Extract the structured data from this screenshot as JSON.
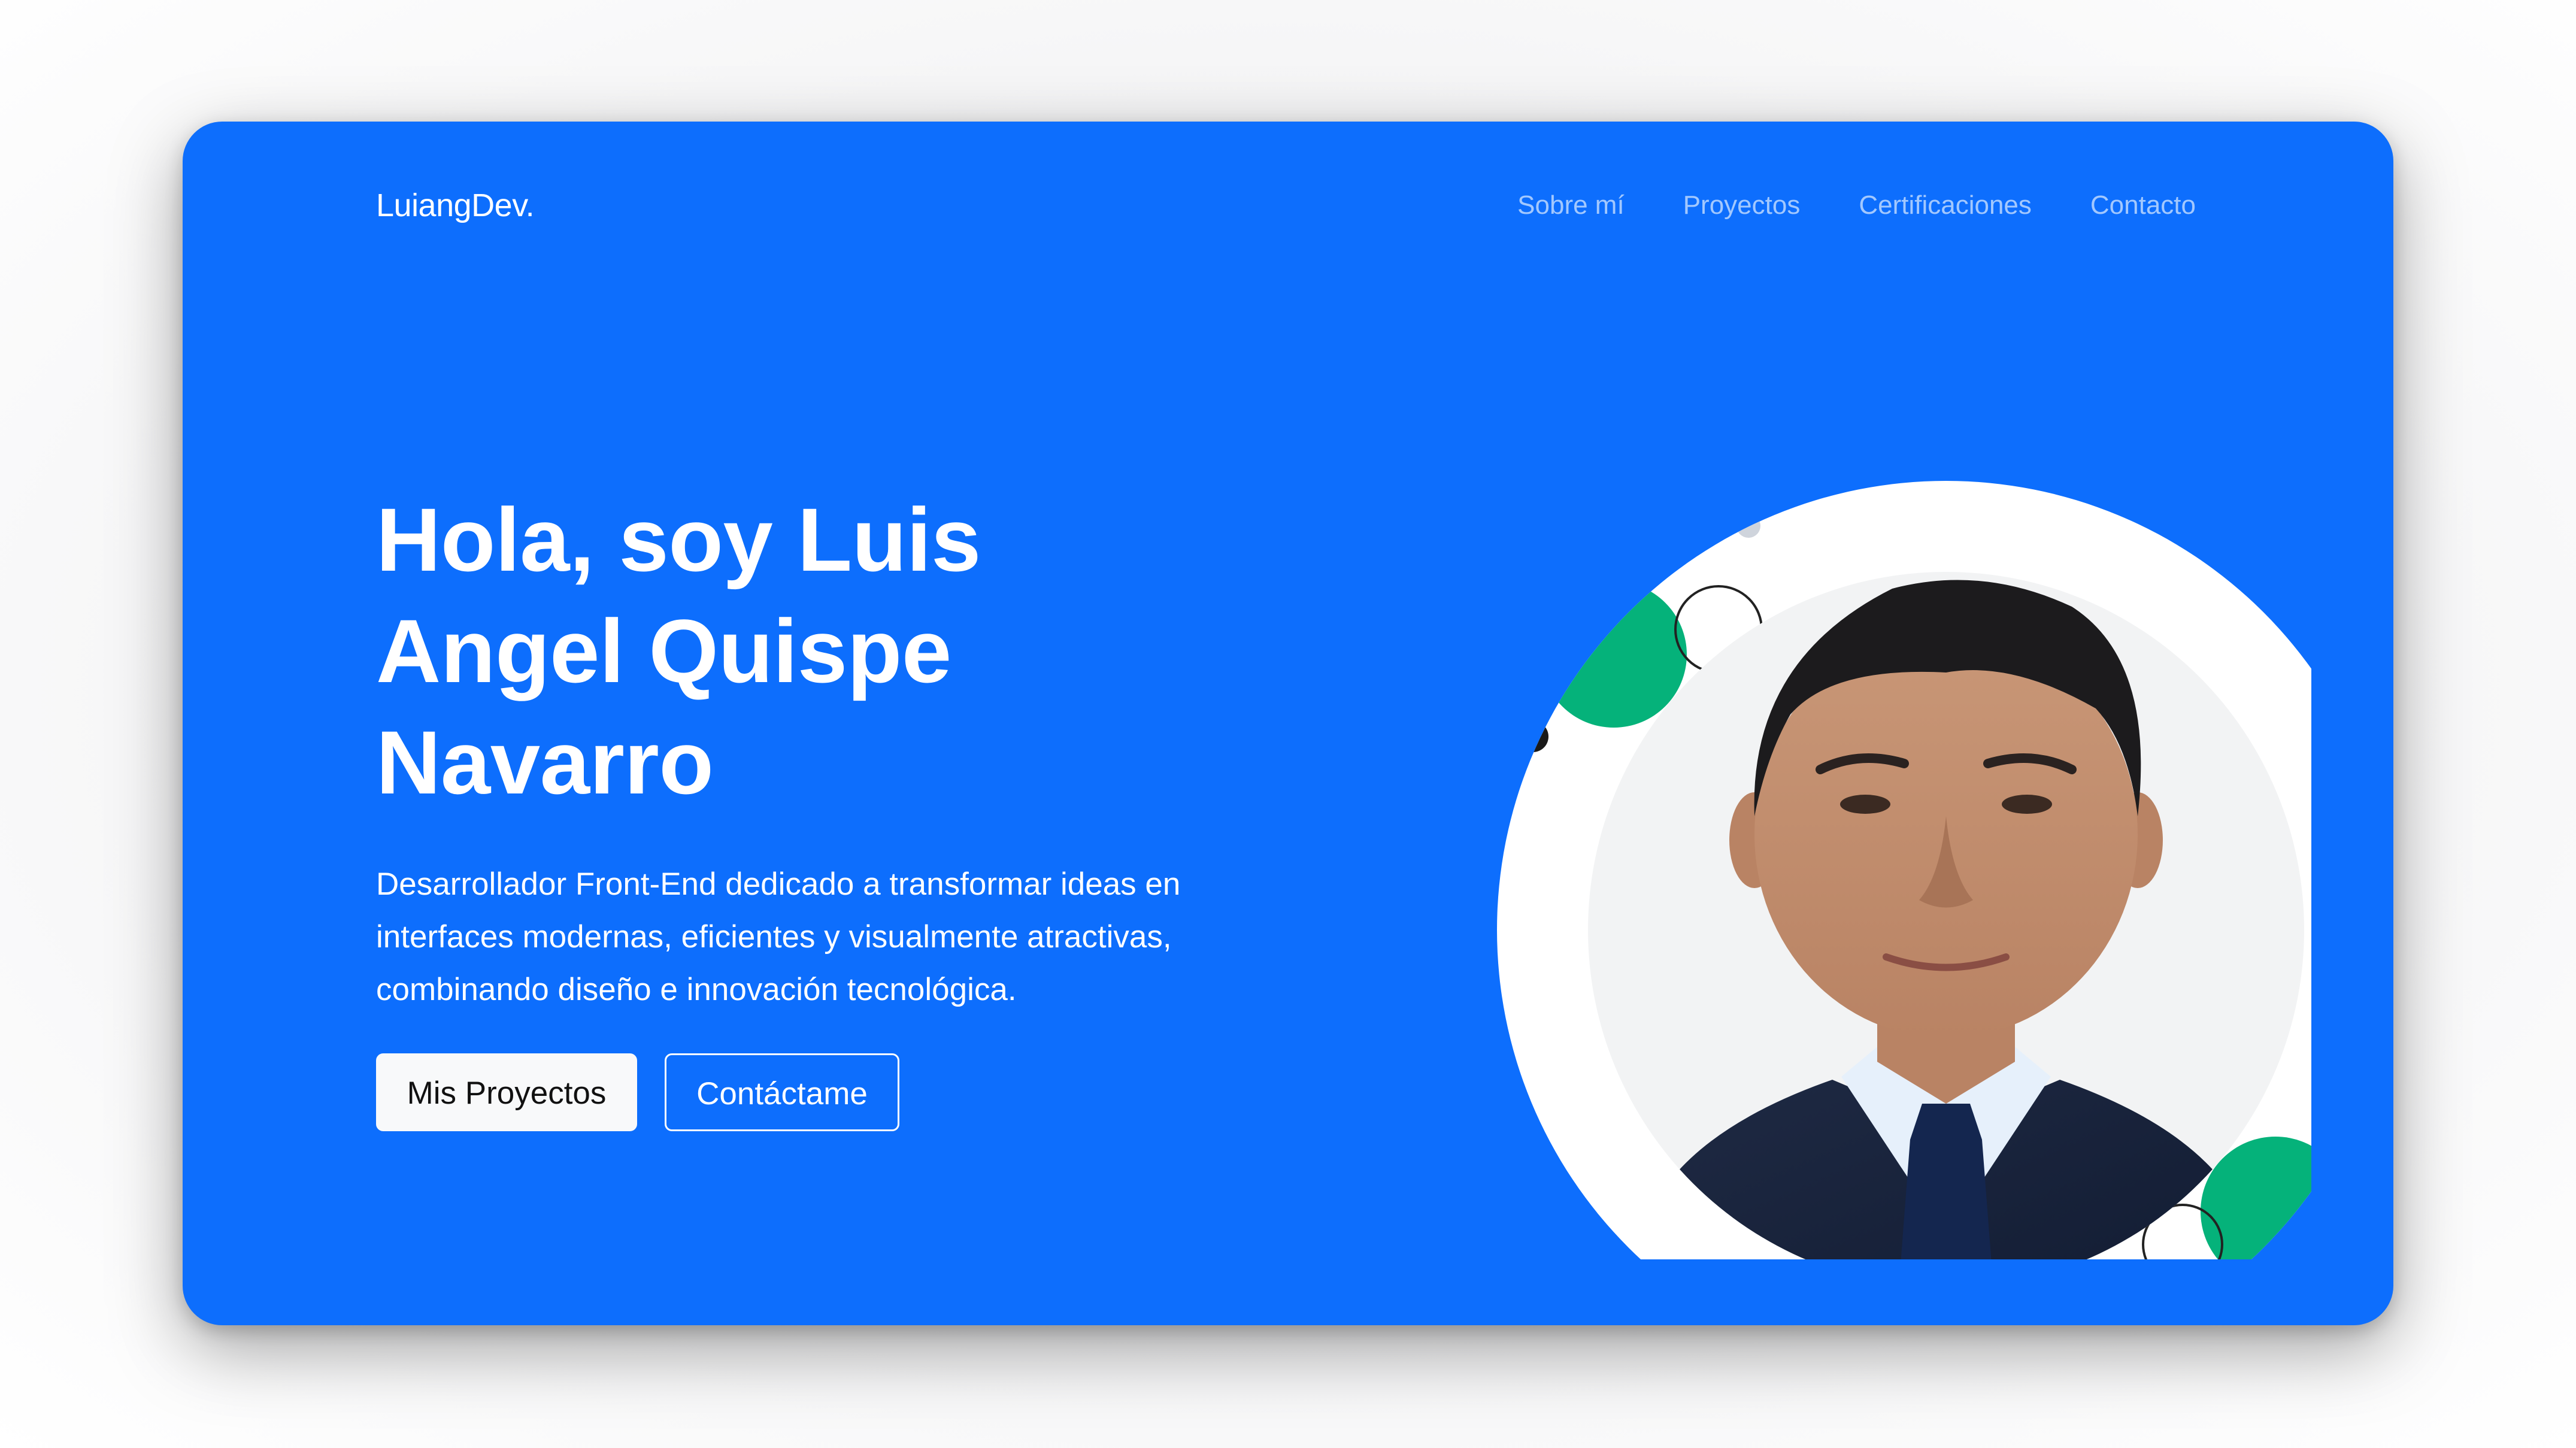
{
  "brand": "LuiangDev.",
  "nav": {
    "items": [
      {
        "label": "Sobre mí"
      },
      {
        "label": "Proyectos"
      },
      {
        "label": "Certificaciones"
      },
      {
        "label": "Contacto"
      }
    ]
  },
  "hero": {
    "title_lines": [
      "Hola, soy Luis",
      "Angel Quispe",
      "Navarro"
    ],
    "description": "Desarrollador Front-End dedicado a transformar ideas en interfaces modernas, eficientes y visualmente atractivas, combinando diseño e innovación tecnológica.",
    "primary_button": "Mis Proyectos",
    "secondary_button": "Contáctame"
  },
  "colors": {
    "background": "#0d6efd",
    "accent_green": "#05b27a",
    "button_light": "#f8f9fa",
    "nav_text": "rgba(255,255,255,0.62)"
  },
  "profile_photo": {
    "icon": "profile-photo",
    "description_shown": false
  }
}
